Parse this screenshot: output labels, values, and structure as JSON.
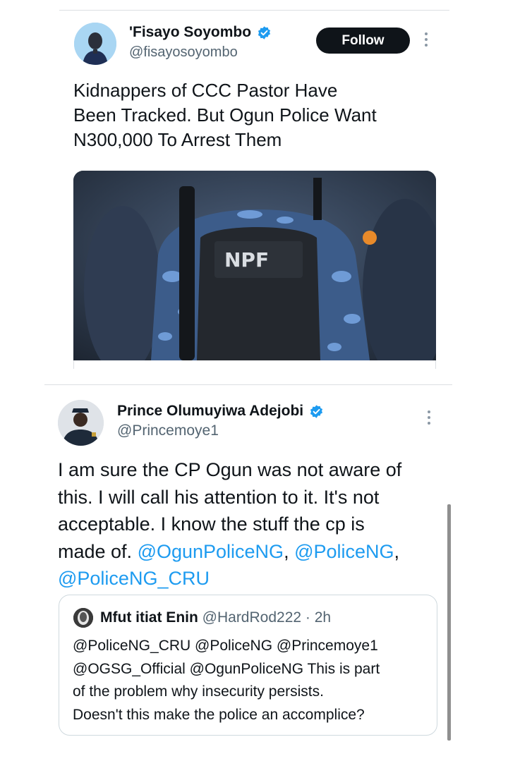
{
  "tweet1": {
    "author_name": "'Fisayo Soyombo",
    "author_handle": "@fisayosoyombo",
    "follow_label": "Follow",
    "text_lines": [
      "Kidnappers of CCC Pastor Have",
      "Been Tracked. But Ogun Police Want",
      "N300,000 To Arrest Them"
    ],
    "image_text": "NPF"
  },
  "tweet2": {
    "author_name": "Prince Olumuyiwa Adejobi",
    "author_handle": "@Princemoye1",
    "text_line1": "I am sure the CP Ogun was not aware of",
    "text_line2": "this. I will call his attention to it. It's not",
    "text_line3": "acceptable. I know the stuff the cp is",
    "text_line4_prefix": "made of. ",
    "mention1": "@OgunPoliceNG",
    "sep1": ", ",
    "mention2": "@PoliceNG",
    "sep2": ",",
    "mention3": "@PoliceNG_CRU"
  },
  "quote": {
    "author_name": "Mfut itiat Enin",
    "author_handle": "@HardRod222",
    "time": "· 2h",
    "text_lines": [
      "@PoliceNG_CRU @PoliceNG @Princemoye1",
      "@OGSG_Official @OgunPoliceNG This is part",
      "of the problem why insecurity persists.",
      "Doesn't this make the police an accomplice?"
    ]
  },
  "colors": {
    "verified_blue": "#1d9bf0",
    "mention_blue": "#1d9bf0",
    "handle_gray": "#536471",
    "follow_bg": "#0f1419"
  },
  "icons": [
    "verified-badge-icon",
    "more-options-icon"
  ]
}
